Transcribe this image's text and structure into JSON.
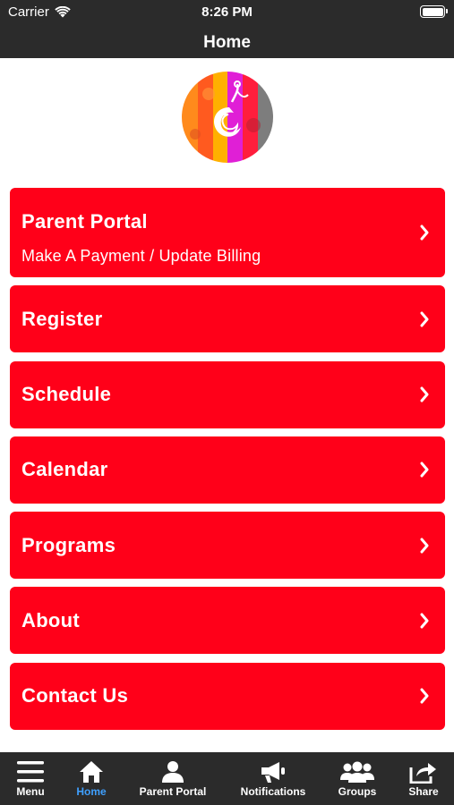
{
  "status_bar": {
    "carrier": "Carrier",
    "time": "8:26 PM"
  },
  "nav": {
    "title": "Home"
  },
  "menu": [
    {
      "label": "Parent Portal",
      "sublabel": "Make A Payment / Update Billing"
    },
    {
      "label": "Register"
    },
    {
      "label": "Schedule"
    },
    {
      "label": "Calendar"
    },
    {
      "label": "Programs"
    },
    {
      "label": "About"
    },
    {
      "label": "Contact Us"
    }
  ],
  "tabs": [
    {
      "label": "Menu",
      "icon": "hamburger-icon"
    },
    {
      "label": "Home",
      "icon": "home-icon",
      "active": true
    },
    {
      "label": "Parent Portal",
      "icon": "person-icon"
    },
    {
      "label": "Notifications",
      "icon": "megaphone-icon"
    },
    {
      "label": "Groups",
      "icon": "group-icon"
    },
    {
      "label": "Share",
      "icon": "share-icon"
    }
  ],
  "colors": {
    "bar_bg": "#2b2b2b",
    "button_red": "#ff0019",
    "active_tab": "#3fa0ff"
  }
}
